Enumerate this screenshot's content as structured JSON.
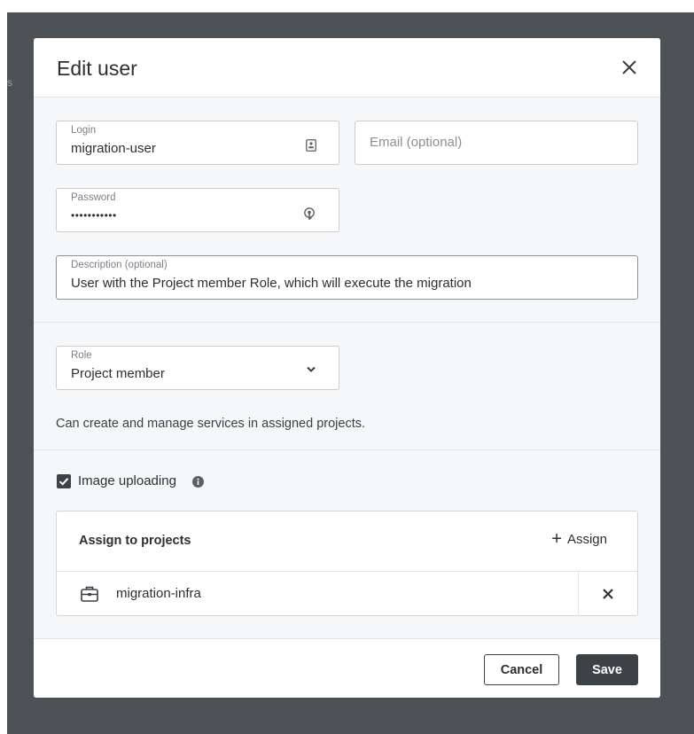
{
  "background": {
    "hint_char": "s"
  },
  "modal": {
    "title": "Edit user",
    "close_label": "×"
  },
  "form": {
    "login": {
      "label": "Login",
      "value": "migration-user"
    },
    "email": {
      "placeholder": "Email (optional)"
    },
    "password": {
      "label": "Password",
      "value": "•••••••••••"
    },
    "description": {
      "label": "Description (optional)",
      "value": "User with the Project member Role, which will execute the migration"
    },
    "role": {
      "label": "Role",
      "value": "Project member",
      "description": "Can create and manage services in assigned projects."
    }
  },
  "image_uploading": {
    "label": "Image uploading",
    "checked": true
  },
  "assign": {
    "title": "Assign to projects",
    "action_label": "Assign",
    "projects": [
      {
        "name": "migration-infra"
      }
    ]
  },
  "footer": {
    "cancel_label": "Cancel",
    "save_label": "Save"
  },
  "colors": {
    "backdrop": "#4d5256",
    "modal_bg": "#f6f7f8",
    "primary_button": "#3d4247"
  },
  "icons": {
    "close": "close-icon",
    "login_field": "id-card-icon",
    "password_field": "key-icon",
    "role_dropdown": "chevron-down-icon",
    "checkbox": "checkmark-icon",
    "info": "info-icon",
    "assign": "plus-icon",
    "project": "briefcase-icon",
    "remove": "close-icon"
  }
}
